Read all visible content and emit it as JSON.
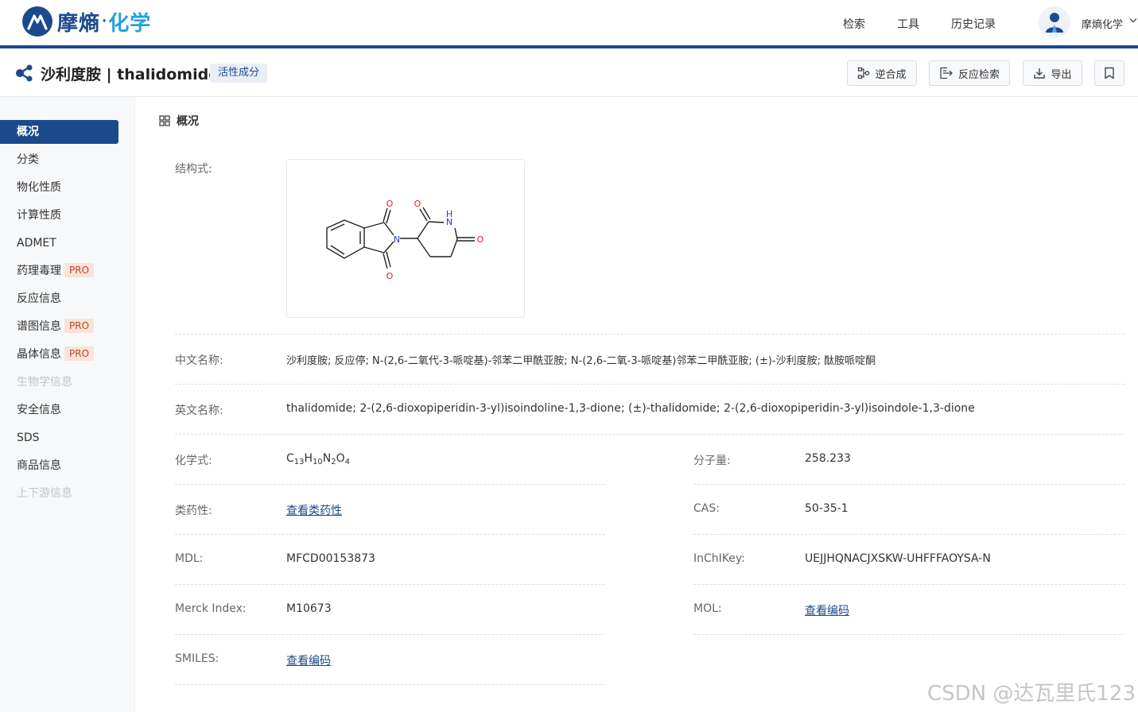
{
  "brand": {
    "name_main": "摩熵",
    "name_dot": "·",
    "name_sub": "化学"
  },
  "topnav": [
    "检索",
    "工具",
    "历史记录"
  ],
  "user": {
    "name": "摩熵化学"
  },
  "header": {
    "title": "沙利度胺 | thalidomide",
    "tag": "活性成分",
    "buttons": {
      "retro": "逆合成",
      "reaction_search": "反应检索",
      "export": "导出"
    }
  },
  "sidebar": {
    "items": [
      {
        "label": "概况",
        "state": "active"
      },
      {
        "label": "分类"
      },
      {
        "label": "物化性质"
      },
      {
        "label": "计算性质"
      },
      {
        "label": "ADMET"
      },
      {
        "label": "药理毒理",
        "badge": "PRO"
      },
      {
        "label": "反应信息"
      },
      {
        "label": "谱图信息",
        "badge": "PRO"
      },
      {
        "label": "晶体信息",
        "badge": "PRO"
      },
      {
        "label": "生物学信息",
        "state": "disabled"
      },
      {
        "label": "安全信息"
      },
      {
        "label": "SDS"
      },
      {
        "label": "商品信息"
      },
      {
        "label": "上下游信息",
        "state": "disabled"
      }
    ]
  },
  "overview": {
    "section_title": "概况",
    "structure_label": "结构式:",
    "structure_atoms": {
      "o": "O",
      "n": "N",
      "nh_h": "H",
      "nh_n": "N"
    },
    "cn_name_label": "中文名称:",
    "cn_name": "沙利度胺; 反应停; N-(2,6-二氧代-3-哌啶基)-邻苯二甲酰亚胺; N-(2,6-二氧-3-哌啶基)邻苯二甲酰亚胺; (±)-沙利度胺; 酞胺哌啶酮",
    "en_name_label": "英文名称:",
    "en_name": "thalidomide; 2-(2,6-dioxopiperidin-3-yl)isoindoline-1,3-dione; (±)-thalidomide; 2-(2,6-dioxopiperidin-3-yl)isoindole-1,3-dione",
    "formula_label": "化学式:",
    "formula": {
      "c": "C",
      "c_n": "13",
      "h": "H",
      "h_n": "10",
      "n": "N",
      "n_n": "2",
      "o": "O",
      "o_n": "4"
    },
    "mw_label": "分子量:",
    "mw": "258.233",
    "druglike_label": "类药性:",
    "druglike_link": "查看类药性",
    "cas_label": "CAS:",
    "cas": "50-35-1",
    "mdl_label": "MDL:",
    "mdl": "MFCD00153873",
    "inchikey_label": "InChIKey:",
    "inchikey": "UEJJHQNACJXSKW-UHFFFAOYSA-N",
    "merck_label": "Merck Index:",
    "merck": "M10673",
    "mol_label": "MOL:",
    "mol_link": "查看编码",
    "smiles_label": "SMILES:",
    "smiles_link": "查看编码"
  },
  "watermark": "CSDN @达瓦里氏123"
}
